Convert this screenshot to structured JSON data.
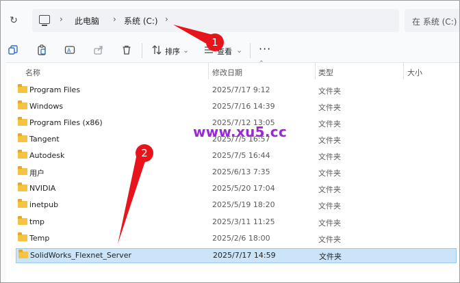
{
  "address_bar": {
    "crumbs": [
      "此电脑",
      "系统 (C:)"
    ],
    "search_placeholder": "在 系统 (C:)"
  },
  "toolbar": {
    "sort_label": "排序",
    "view_label": "查看"
  },
  "columns": {
    "name": "名称",
    "modified": "修改日期",
    "type": "类型",
    "size": "大小"
  },
  "files": [
    {
      "name": "Program Files",
      "modified": "2025/7/17 9:12",
      "type": "文件夹"
    },
    {
      "name": "Windows",
      "modified": "2025/7/16 14:39",
      "type": "文件夹"
    },
    {
      "name": "Program Files (x86)",
      "modified": "2025/7/12 13:05",
      "type": "文件夹"
    },
    {
      "name": "Tangent",
      "modified": "2025/7/5 16:57",
      "type": "文件夹"
    },
    {
      "name": "Autodesk",
      "modified": "2025/7/5 16:44",
      "type": "文件夹"
    },
    {
      "name": "用户",
      "modified": "2025/6/13 7:35",
      "type": "文件夹"
    },
    {
      "name": "NVIDIA",
      "modified": "2025/5/20 17:04",
      "type": "文件夹"
    },
    {
      "name": "inetpub",
      "modified": "2025/5/19 18:20",
      "type": "文件夹"
    },
    {
      "name": "tmp",
      "modified": "2025/3/11 11:25",
      "type": "文件夹"
    },
    {
      "name": "Temp",
      "modified": "2025/2/6 18:00",
      "type": "文件夹"
    },
    {
      "name": "SolidWorks_Flexnet_Server",
      "modified": "2025/7/17 14:59",
      "type": "文件夹",
      "selected": true
    }
  ],
  "annotations": {
    "watermark": "www.xu5.cc",
    "badge1": "1",
    "badge2": "2",
    "color": "#e8141b"
  }
}
